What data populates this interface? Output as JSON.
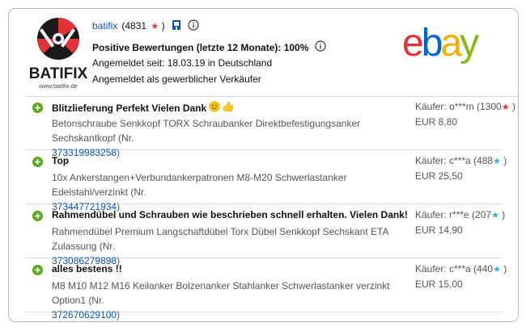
{
  "seller": {
    "logo_text": "BATIFIX",
    "logo_url": "www.batifix.de",
    "name": "batifix",
    "score": "(4831",
    "score_close": ")",
    "positive_feedback": "Positive Bewertungen (letzte 12 Monate): 100%",
    "member_since": "Angemeldet seit: 18.03.19 in Deutschland",
    "seller_type": "Angemeldet als gewerblicher Verkäufer"
  },
  "brand": {
    "letters": [
      "e",
      "b",
      "a",
      "y"
    ],
    "colors": [
      "#e53238",
      "#0064d2",
      "#f5af02",
      "#86b817"
    ]
  },
  "feedback": [
    {
      "comment": "Blitzlieferung Perfekt Vielen Dank",
      "emojis": [
        "slightly-smiling-face",
        "thumbs-up"
      ],
      "item": "Betonschraube Senkkopf TORX Schraubanker Direktbefestigungsanker Sechskantkopf (Nr.",
      "item_number": "373319983258",
      "item_close": ")",
      "buyer": "Käufer: o***m (1300",
      "buyer_close": " )",
      "star_color": "red",
      "price": "EUR 8,80"
    },
    {
      "comment": "Top",
      "emojis": [],
      "item": "10x Ankerstangen+Verbundankerpatronen M8-M20 Schwerlastanker Edelstahl/verzinkt (Nr.",
      "item_number": "373447721934",
      "item_close": ")",
      "buyer": "Käufer: c***a (488",
      "buyer_close": " )",
      "star_color": "turquoise",
      "price": "EUR 25,50"
    },
    {
      "comment": "Rahmendübel und Schrauben wie beschrieben schnell erhalten. Vielen Dank!",
      "emojis": [],
      "item": "Rahmendübel Premium Langschaftdübel Torx Dübel Senkkopf Sechskant ETA Zulassung (Nr.",
      "item_number": "373086279898",
      "item_close": ")",
      "buyer": "Käufer: r***e (207",
      "buyer_close": " )",
      "star_color": "turquoise",
      "price": "EUR 14,90"
    },
    {
      "comment": "alles bestens !!",
      "emojis": [],
      "item": "M8 M10 M12 M16 Keilanker Bolzenanker Stahlanker Schwerlastanker verzinkt Option1 (Nr.",
      "item_number": "372670629100",
      "item_close": ")",
      "buyer": "Käufer: c***a (440",
      "buyer_close": " )",
      "star_color": "turquoise",
      "price": "EUR 15,00"
    }
  ]
}
